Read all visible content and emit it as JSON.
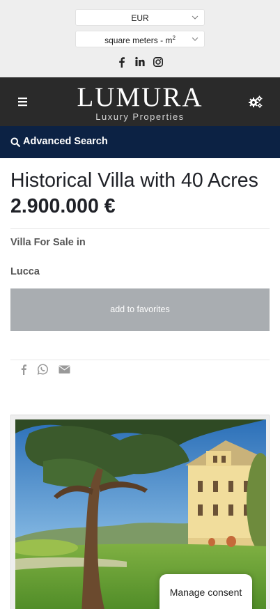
{
  "topbar": {
    "currency": "EUR",
    "units_prefix": "square meters - m",
    "units_sup": "2",
    "social_icons": [
      "facebook-icon",
      "linkedin-icon",
      "instagram-icon"
    ]
  },
  "header": {
    "brand": "LUMURA",
    "tagline": "Luxury Properties"
  },
  "search": {
    "label": "Advanced Search"
  },
  "listing": {
    "title": "Historical Villa with 40 Acres",
    "price": "2.900.000 €",
    "type_line": "Villa For Sale in",
    "city": "Lucca",
    "favorite_label": "add to favorites"
  },
  "share_icons": [
    "facebook-icon",
    "whatsapp-icon",
    "email-icon"
  ],
  "consent": {
    "label": "Manage consent"
  },
  "colors": {
    "topbar_bg": "#eeeeee",
    "header_bg": "#2a2a2a",
    "search_bg": "#0c2244",
    "favorite_bg": "#a9adb1"
  }
}
